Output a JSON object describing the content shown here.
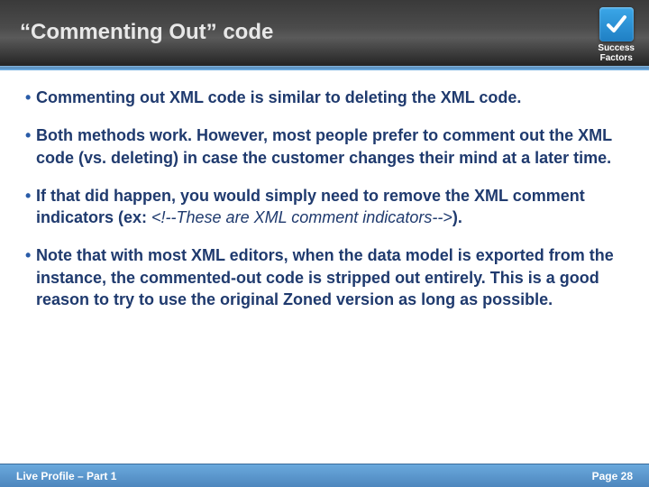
{
  "header": {
    "title": "“Commenting Out” code",
    "logo_line1": "Success",
    "logo_line2": "Factors"
  },
  "bullets": {
    "b1": "Commenting out XML code is similar to deleting the XML code.",
    "b2": "Both methods work.  However, most people prefer to comment out the XML code (vs. deleting) in case the customer changes their mind at a later time.",
    "b3_pre": "If that did happen, you would simply need to remove the XML comment indicators (ex: ",
    "b3_italic": "<!--These are XML comment indicators-->",
    "b3_post": ").",
    "b4": "Note that with most XML editors, when the data model is exported from the instance, the commented-out code is stripped out entirely.  This is a good reason to try to use the original Zoned version as long as possible."
  },
  "footer": {
    "left": "Live Profile – Part 1",
    "right": "Page 28"
  }
}
